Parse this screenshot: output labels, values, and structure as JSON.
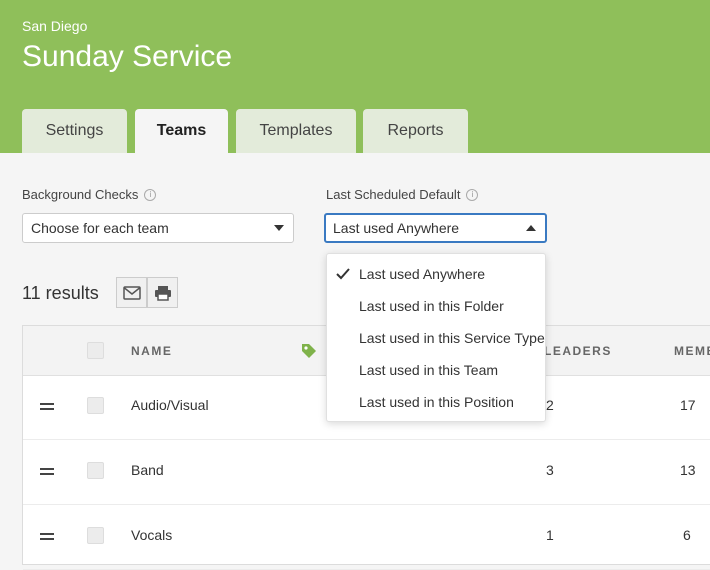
{
  "header": {
    "location": "San Diego",
    "title": "Sunday Service",
    "tabs": [
      "Settings",
      "Teams",
      "Templates",
      "Reports"
    ],
    "active_tab": "Teams",
    "color": "#8fbf5a"
  },
  "filters": {
    "background_checks": {
      "label": "Background Checks",
      "value": "Choose for each team"
    },
    "last_scheduled_default": {
      "label": "Last Scheduled Default",
      "value": "Last used Anywhere"
    }
  },
  "dropdown": {
    "options": [
      "Last used Anywhere",
      "Last used in this Folder",
      "Last used in this Service Type",
      "Last used in this Team",
      "Last used in this Position"
    ],
    "selected": "Last used Anywhere"
  },
  "results": {
    "count_text": "11 results"
  },
  "table": {
    "columns": [
      "NAME",
      "LEADERS",
      "MEMB"
    ],
    "rows": [
      {
        "name": "Audio/Visual",
        "leaders": "2",
        "members": "17"
      },
      {
        "name": "Band",
        "leaders": "3",
        "members": "13"
      },
      {
        "name": "Vocals",
        "leaders": "1",
        "members": "6"
      }
    ]
  },
  "icons": [
    "info-icon",
    "chevron-down-icon",
    "chevron-up-icon",
    "email-icon",
    "print-icon",
    "tag-icon",
    "drag-handle-icon",
    "checkmark-icon"
  ]
}
